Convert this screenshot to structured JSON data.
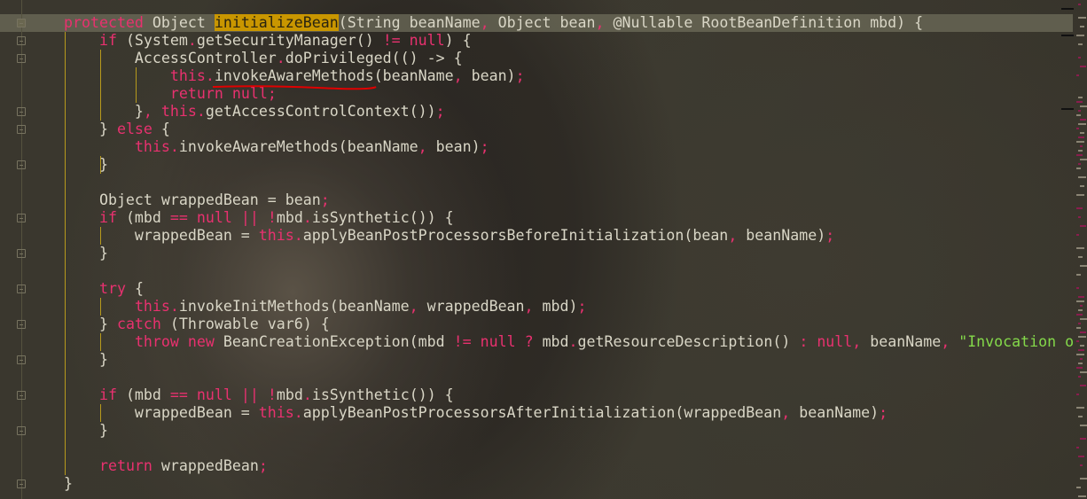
{
  "editor": {
    "colors": {
      "keyword": "#e8316f",
      "text": "#d9d6c6",
      "string": "#84d94a",
      "highlight": "#c99600",
      "error_underline": "#e00000"
    },
    "lines": [
      [
        [
          "k",
          "protected"
        ],
        [
          "p",
          " Object "
        ],
        [
          "h",
          "initializeBean"
        ],
        [
          "p",
          "(String beanName"
        ],
        [
          "k",
          ","
        ],
        [
          "p",
          " Object bean"
        ],
        [
          "k",
          ","
        ],
        [
          "p",
          " @Nullable RootBeanDefinition mbd) {"
        ]
      ],
      [
        [
          "p",
          "    "
        ],
        [
          "k",
          "if"
        ],
        [
          "p",
          " (System"
        ],
        [
          "k",
          "."
        ],
        [
          "p",
          "getSecurityManager() "
        ],
        [
          "k",
          "!="
        ],
        [
          "p",
          " "
        ],
        [
          "k",
          "null"
        ],
        [
          "p",
          ") {"
        ]
      ],
      [
        [
          "p",
          "        AccessController"
        ],
        [
          "k",
          "."
        ],
        [
          "p",
          "doPrivileged(() -> {"
        ]
      ],
      [
        [
          "p",
          "            "
        ],
        [
          "k",
          "this"
        ],
        [
          "k",
          "."
        ],
        [
          "p",
          "invokeAwareMethods(beanName"
        ],
        [
          "k",
          ","
        ],
        [
          "p",
          " bean)"
        ],
        [
          "k",
          ";"
        ]
      ],
      [
        [
          "p",
          "            "
        ],
        [
          "k",
          "return"
        ],
        [
          "p",
          " "
        ],
        [
          "k",
          "null"
        ],
        [
          "k",
          ";"
        ]
      ],
      [
        [
          "p",
          "        }"
        ],
        [
          "k",
          ","
        ],
        [
          "p",
          " "
        ],
        [
          "k",
          "this"
        ],
        [
          "k",
          "."
        ],
        [
          "p",
          "getAccessControlContext())"
        ],
        [
          "k",
          ";"
        ]
      ],
      [
        [
          "p",
          "    } "
        ],
        [
          "k",
          "else"
        ],
        [
          "p",
          " {"
        ]
      ],
      [
        [
          "p",
          "        "
        ],
        [
          "k",
          "this"
        ],
        [
          "k",
          "."
        ],
        [
          "p",
          "invokeAwareMethods(beanName"
        ],
        [
          "k",
          ","
        ],
        [
          "p",
          " bean)"
        ],
        [
          "k",
          ";"
        ]
      ],
      [
        [
          "p",
          "    }"
        ]
      ],
      [],
      [
        [
          "p",
          "    Object wrappedBean = bean"
        ],
        [
          "k",
          ";"
        ]
      ],
      [
        [
          "p",
          "    "
        ],
        [
          "k",
          "if"
        ],
        [
          "p",
          " (mbd "
        ],
        [
          "k",
          "=="
        ],
        [
          "p",
          " "
        ],
        [
          "k",
          "null"
        ],
        [
          "p",
          " "
        ],
        [
          "k",
          "||"
        ],
        [
          "p",
          " "
        ],
        [
          "k",
          "!"
        ],
        [
          "p",
          "mbd"
        ],
        [
          "k",
          "."
        ],
        [
          "p",
          "isSynthetic()) {"
        ]
      ],
      [
        [
          "p",
          "        wrappedBean = "
        ],
        [
          "k",
          "this"
        ],
        [
          "k",
          "."
        ],
        [
          "p",
          "applyBeanPostProcessorsBeforeInitialization(bean"
        ],
        [
          "k",
          ","
        ],
        [
          "p",
          " beanName)"
        ],
        [
          "k",
          ";"
        ]
      ],
      [
        [
          "p",
          "    }"
        ]
      ],
      [],
      [
        [
          "p",
          "    "
        ],
        [
          "k",
          "try"
        ],
        [
          "p",
          " {"
        ]
      ],
      [
        [
          "p",
          "        "
        ],
        [
          "k",
          "this"
        ],
        [
          "k",
          "."
        ],
        [
          "p",
          "invokeInitMethods(beanName"
        ],
        [
          "k",
          ","
        ],
        [
          "p",
          " wrappedBean"
        ],
        [
          "k",
          ","
        ],
        [
          "p",
          " mbd)"
        ],
        [
          "k",
          ";"
        ]
      ],
      [
        [
          "p",
          "    } "
        ],
        [
          "k",
          "catch"
        ],
        [
          "p",
          " (Throwable var6) {"
        ]
      ],
      [
        [
          "p",
          "        "
        ],
        [
          "k",
          "throw"
        ],
        [
          "p",
          " "
        ],
        [
          "k",
          "new"
        ],
        [
          "p",
          " BeanCreationException(mbd "
        ],
        [
          "k",
          "!="
        ],
        [
          "p",
          " "
        ],
        [
          "k",
          "null"
        ],
        [
          "p",
          " "
        ],
        [
          "k",
          "?"
        ],
        [
          "p",
          " mbd"
        ],
        [
          "k",
          "."
        ],
        [
          "p",
          "getResourceDescription() "
        ],
        [
          "k",
          ":"
        ],
        [
          "p",
          " "
        ],
        [
          "k",
          "null"
        ],
        [
          "k",
          ","
        ],
        [
          "p",
          " beanName"
        ],
        [
          "k",
          ","
        ],
        [
          "p",
          " "
        ],
        [
          "s",
          "\"Invocation o"
        ]
      ],
      [
        [
          "p",
          "    }"
        ]
      ],
      [],
      [
        [
          "p",
          "    "
        ],
        [
          "k",
          "if"
        ],
        [
          "p",
          " (mbd "
        ],
        [
          "k",
          "=="
        ],
        [
          "p",
          " "
        ],
        [
          "k",
          "null"
        ],
        [
          "p",
          " "
        ],
        [
          "k",
          "||"
        ],
        [
          "p",
          " "
        ],
        [
          "k",
          "!"
        ],
        [
          "p",
          "mbd"
        ],
        [
          "k",
          "."
        ],
        [
          "p",
          "isSynthetic()) {"
        ]
      ],
      [
        [
          "p",
          "        wrappedBean = "
        ],
        [
          "k",
          "this"
        ],
        [
          "k",
          "."
        ],
        [
          "p",
          "applyBeanPostProcessorsAfterInitialization(wrappedBean"
        ],
        [
          "k",
          ","
        ],
        [
          "p",
          " beanName)"
        ],
        [
          "k",
          ";"
        ]
      ],
      [
        [
          "p",
          "    }"
        ]
      ],
      [],
      [
        [
          "p",
          "    "
        ],
        [
          "k",
          "return"
        ],
        [
          "p",
          " wrappedBean"
        ],
        [
          "k",
          ";"
        ]
      ],
      [
        [
          "p",
          "}"
        ]
      ]
    ]
  }
}
